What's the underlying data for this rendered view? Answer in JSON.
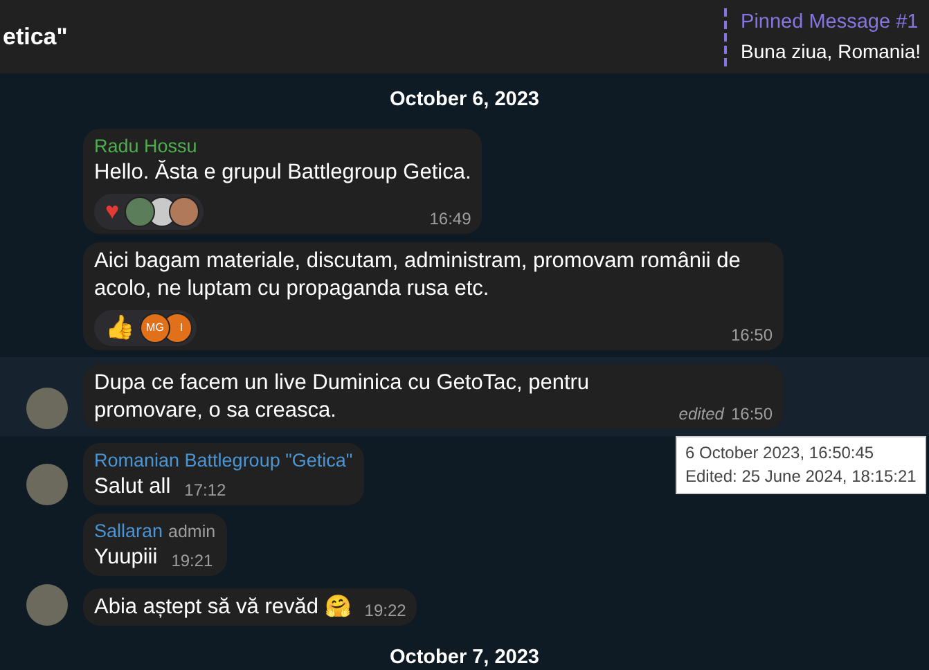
{
  "header": {
    "title": "etica\"",
    "pinned": {
      "label": "Pinned Message #1",
      "text": "Buna ziua, Romania!"
    }
  },
  "items": [
    {
      "kind": "date",
      "label": "October 6, 2023"
    },
    {
      "kind": "message",
      "author": "Radu Hossu",
      "color": "#4fae4e",
      "text": "Hello. Ăsta e grupul Battlegroup Getica.",
      "time": "16:49",
      "avatar": false,
      "highlighted": false,
      "reactions": [
        {
          "emoji": "♥",
          "voters": [
            {
              "kind": "photo"
            },
            {
              "kind": "photo"
            },
            {
              "kind": "photo"
            }
          ]
        }
      ]
    },
    {
      "kind": "message",
      "text": "Aici bagam materiale, discutam, administram, promovam românii de acolo, ne luptam cu propaganda rusa etc.",
      "time": "16:50",
      "avatar": false,
      "highlighted": false,
      "reactions": [
        {
          "emoji": "👍",
          "voters": [
            {
              "kind": "initials",
              "initials": "MG"
            },
            {
              "kind": "initials",
              "initials": "I"
            }
          ]
        }
      ]
    },
    {
      "kind": "message",
      "text": "Dupa ce facem un live Duminica cu GetoTac, pentru promovare, o sa creasca.",
      "edited": "edited",
      "time": "16:50",
      "avatar": true,
      "highlighted": true
    },
    {
      "kind": "message",
      "author": "Romanian Battlegroup \"Getica\"",
      "color": "#4a95d6",
      "text": "Salut all",
      "time": "17:12",
      "avatar": true,
      "highlighted": false
    },
    {
      "kind": "message",
      "author": "Sallaran",
      "color": "#4a95d6",
      "badge": "admin",
      "text": "Yuupiii",
      "time": "19:21",
      "avatar": false,
      "highlighted": false
    },
    {
      "kind": "message",
      "text": "Abia aștept să vă revăd 🤗",
      "time": "19:22",
      "avatar": true,
      "highlighted": false
    },
    {
      "kind": "date",
      "label": "October 7, 2023"
    }
  ],
  "tooltip": {
    "lines": [
      "6 October 2023, 16:50:45",
      "Edited: 25 June 2024, 18:15:21"
    ]
  }
}
